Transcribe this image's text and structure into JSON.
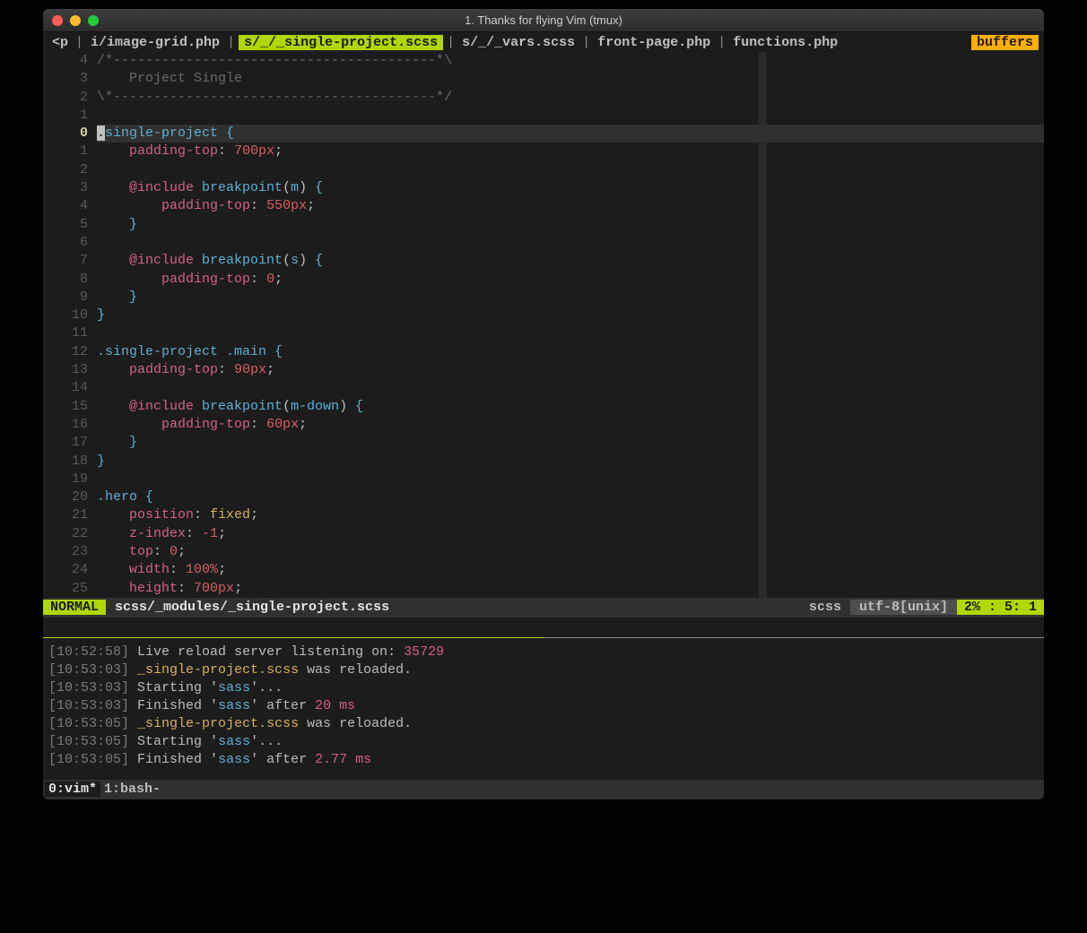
{
  "window": {
    "title": "1. Thanks for flying Vim (tmux)"
  },
  "tabs": {
    "prefix": "<p",
    "items": [
      "i/image-grid.php",
      "s/_/_single-project.scss",
      "s/_/_vars.scss",
      "front-page.php",
      "functions.php"
    ],
    "activeIndex": 1,
    "buffers_label": "buffers"
  },
  "gutter": [
    "4",
    "3",
    "2",
    "1",
    "0",
    "1",
    "2",
    "3",
    "4",
    "5",
    "6",
    "7",
    "8",
    "9",
    "10",
    "11",
    "12",
    "13",
    "14",
    "15",
    "16",
    "17",
    "18",
    "19",
    "20",
    "21",
    "22",
    "23",
    "24",
    "25"
  ],
  "cursorRow": 4,
  "code": {
    "lines": [
      {
        "t": "comment",
        "text": "/*----------------------------------------*\\"
      },
      {
        "t": "comment",
        "text": "    Project Single"
      },
      {
        "t": "comment",
        "text": "\\*----------------------------------------*/"
      },
      {
        "t": "blank",
        "text": ""
      },
      {
        "t": "sel-open",
        "cursor": ".",
        "sel": "single-project"
      },
      {
        "t": "decl",
        "indent": "    ",
        "prop": "padding-top",
        "val": "700px"
      },
      {
        "t": "blank",
        "text": ""
      },
      {
        "t": "include",
        "indent": "    ",
        "fn": "breakpoint",
        "arg": "m"
      },
      {
        "t": "decl",
        "indent": "        ",
        "prop": "padding-top",
        "val": "550px"
      },
      {
        "t": "close",
        "indent": "    "
      },
      {
        "t": "blank",
        "text": ""
      },
      {
        "t": "include",
        "indent": "    ",
        "fn": "breakpoint",
        "arg": "s"
      },
      {
        "t": "decl-zero",
        "indent": "        ",
        "prop": "padding-top",
        "val": "0"
      },
      {
        "t": "close",
        "indent": "    "
      },
      {
        "t": "close",
        "indent": ""
      },
      {
        "t": "blank",
        "text": ""
      },
      {
        "t": "sel-open2",
        "sel": ".single-project .main"
      },
      {
        "t": "decl",
        "indent": "    ",
        "prop": "padding-top",
        "val": "90px"
      },
      {
        "t": "blank",
        "text": ""
      },
      {
        "t": "include",
        "indent": "    ",
        "fn": "breakpoint",
        "arg": "m-down"
      },
      {
        "t": "decl",
        "indent": "        ",
        "prop": "padding-top",
        "val": "60px"
      },
      {
        "t": "close",
        "indent": "    "
      },
      {
        "t": "close",
        "indent": ""
      },
      {
        "t": "blank",
        "text": ""
      },
      {
        "t": "sel-open2",
        "sel": ".hero"
      },
      {
        "t": "decl-kw",
        "indent": "    ",
        "prop": "position",
        "val": "fixed"
      },
      {
        "t": "decl-zero",
        "indent": "    ",
        "prop": "z-index",
        "val": "-1"
      },
      {
        "t": "decl-zero",
        "indent": "    ",
        "prop": "top",
        "val": "0"
      },
      {
        "t": "decl",
        "indent": "    ",
        "prop": "width",
        "val": "100%"
      },
      {
        "t": "decl",
        "indent": "    ",
        "prop": "height",
        "val": "700px"
      }
    ]
  },
  "status": {
    "mode": "NORMAL",
    "file": "scss/_modules/_single-project.scss",
    "filetype": "scss",
    "encoding": "utf-8[unix]",
    "position": "2% :   5:  1"
  },
  "terminal": [
    {
      "time": "10:52:58",
      "segs": [
        {
          "c": "",
          "t": "Live reload server listening on: "
        },
        {
          "c": "t-num",
          "t": "35729"
        }
      ]
    },
    {
      "time": "10:53:03",
      "segs": [
        {
          "c": "t-file",
          "t": "_single-project.scss"
        },
        {
          "c": "",
          "t": " was reloaded."
        }
      ]
    },
    {
      "time": "10:53:03",
      "segs": [
        {
          "c": "",
          "t": "Starting '"
        },
        {
          "c": "t-str",
          "t": "sass"
        },
        {
          "c": "",
          "t": "'..."
        }
      ]
    },
    {
      "time": "10:53:03",
      "segs": [
        {
          "c": "",
          "t": "Finished '"
        },
        {
          "c": "t-str",
          "t": "sass"
        },
        {
          "c": "",
          "t": "' after "
        },
        {
          "c": "t-num",
          "t": "20 ms"
        }
      ]
    },
    {
      "time": "10:53:05",
      "segs": [
        {
          "c": "t-file",
          "t": "_single-project.scss"
        },
        {
          "c": "",
          "t": " was reloaded."
        }
      ]
    },
    {
      "time": "10:53:05",
      "segs": [
        {
          "c": "",
          "t": "Starting '"
        },
        {
          "c": "t-str",
          "t": "sass"
        },
        {
          "c": "",
          "t": "'..."
        }
      ]
    },
    {
      "time": "10:53:05",
      "segs": [
        {
          "c": "",
          "t": "Finished '"
        },
        {
          "c": "t-str",
          "t": "sass"
        },
        {
          "c": "",
          "t": "' after "
        },
        {
          "c": "t-num",
          "t": "2.77 ms"
        }
      ]
    }
  ],
  "tmux": {
    "windows": [
      {
        "label": "0:vim*",
        "active": true
      },
      {
        "label": "1:bash-",
        "active": false
      }
    ]
  }
}
